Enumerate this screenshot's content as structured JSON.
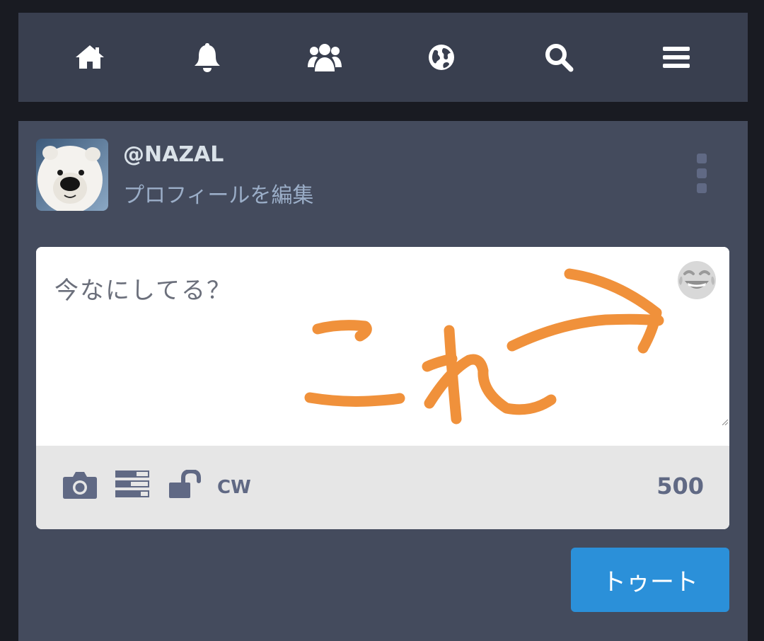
{
  "nav": {
    "items": [
      {
        "icon": "home-icon"
      },
      {
        "icon": "bell-icon"
      },
      {
        "icon": "users-icon"
      },
      {
        "icon": "globe-icon"
      },
      {
        "icon": "search-icon"
      },
      {
        "icon": "menu-icon"
      }
    ]
  },
  "profile": {
    "username": "@NAZAL",
    "edit_link": "プロフィールを編集"
  },
  "composer": {
    "placeholder": "今なにしてる？",
    "annotation_text": "これ",
    "char_count": "500",
    "cw_label": "CW",
    "submit_label": "トゥート"
  },
  "colors": {
    "background": "#191b22",
    "panel": "#444b5d",
    "nav": "#393f4f",
    "accent": "#2b90d9",
    "annotation": "#f0913b",
    "toolbar": "#e6e6e6",
    "muted_icon": "#606984"
  }
}
